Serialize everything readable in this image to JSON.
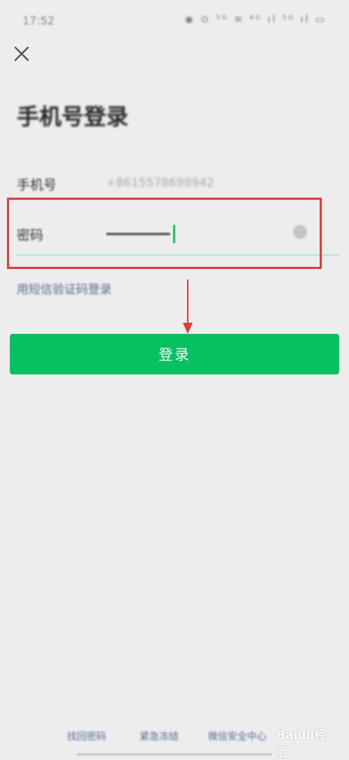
{
  "status_bar": {
    "time": "17:52",
    "icons": "◉ ⊙ ⁵ᴳ ≋ ⁴ᴳ ıl ⁵ᴳ ıl ▭"
  },
  "header": {
    "close_icon": "close-icon",
    "title": "手机号登录"
  },
  "form": {
    "phone_label": "手机号",
    "phone_value": "+8615578698942",
    "password_label": "密码",
    "clear_icon": "clear-icon"
  },
  "sms_login_link": "用短信验证码登录",
  "login_button": "登录",
  "footer": {
    "links": [
      "找回密码",
      "紧急冻结",
      "微信安全中心"
    ]
  },
  "watermark": "Baidu经验",
  "colors": {
    "primary": "#07c160",
    "link": "#566b94",
    "annotation": "#e53935",
    "background": "#ededed"
  }
}
